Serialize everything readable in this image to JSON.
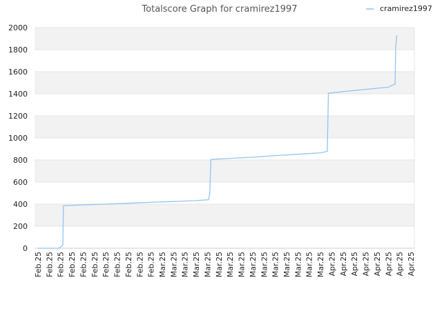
{
  "chart_data": {
    "type": "line",
    "title": "Totalscore Graph for cramirez1997",
    "xlabel": "",
    "ylabel": "",
    "ylim": [
      0,
      2000
    ],
    "yticks": [
      0,
      200,
      400,
      600,
      800,
      1000,
      1200,
      1400,
      1600,
      1800,
      2000
    ],
    "xtick_labels": [
      "Feb.25",
      "Feb.25",
      "Feb.25",
      "Feb.25",
      "Feb.25",
      "Feb.25",
      "Feb.25",
      "Feb.25",
      "Feb.25",
      "Feb.25",
      "Feb.25",
      "Mar.25",
      "Mar.25",
      "Mar.25",
      "Mar.25",
      "Mar.25",
      "Mar.25",
      "Mar.25",
      "Mar.25",
      "Mar.25",
      "Mar.25",
      "Mar.25",
      "Mar.25",
      "Mar.25",
      "Mar.25",
      "Mar.25",
      "Apr.25",
      "Apr.25",
      "Apr.25",
      "Apr.25",
      "Apr.25",
      "Apr.25",
      "Apr.25",
      "Apr.25"
    ],
    "grid": true,
    "legend_position": "top-right",
    "colors": {
      "series": "#90c4f0",
      "band": "#f2f2f2",
      "grid": "#e4e4e4"
    },
    "series": [
      {
        "name": "cramirez1997",
        "points": [
          [
            0,
            0
          ],
          [
            1.8,
            0
          ],
          [
            2.0,
            10
          ],
          [
            2.2,
            30
          ],
          [
            2.25,
            385
          ],
          [
            4,
            393
          ],
          [
            6,
            400
          ],
          [
            8,
            408
          ],
          [
            10,
            416
          ],
          [
            12,
            424
          ],
          [
            14,
            432
          ],
          [
            15.1,
            440
          ],
          [
            15.2,
            500
          ],
          [
            15.3,
            805
          ],
          [
            17,
            815
          ],
          [
            19,
            825
          ],
          [
            21,
            840
          ],
          [
            23,
            852
          ],
          [
            25,
            865
          ],
          [
            25.6,
            878
          ],
          [
            25.7,
            1405
          ],
          [
            27,
            1420
          ],
          [
            29,
            1440
          ],
          [
            31,
            1460
          ],
          [
            31.5,
            1485
          ],
          [
            31.6,
            1485
          ],
          [
            31.65,
            1820
          ],
          [
            31.75,
            1930
          ]
        ]
      }
    ]
  }
}
